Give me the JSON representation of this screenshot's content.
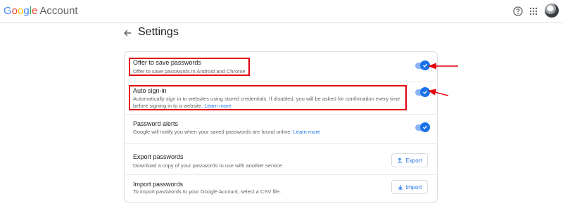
{
  "app": {
    "logo_parts": [
      "G",
      "o",
      "o",
      "g",
      "l",
      "e"
    ],
    "logo_suffix": "Account"
  },
  "header": {
    "icons": [
      "help-icon",
      "apps-grid-icon",
      "avatar"
    ]
  },
  "page": {
    "title": "Settings",
    "back_icon": "arrow-left-icon"
  },
  "settings": {
    "offer_save": {
      "title": "Offer to save passwords",
      "desc": "Offer to save passwords in Android and Chrome",
      "enabled": true
    },
    "auto_signin": {
      "title": "Auto sign-in",
      "desc_line1": "Automatically sign in to websites using stored credentials. If disabled, you will be asked for confirmation every time",
      "desc_line2": "before signing in to a website.",
      "link": "Learn more",
      "enabled": true
    },
    "password_alerts": {
      "title": "Password alerts",
      "desc": "Google will notify you when your saved passwords are found online.",
      "link": "Learn more",
      "enabled": true
    },
    "export": {
      "title": "Export passwords",
      "desc": "Download a copy of your passwords to use with another service",
      "button": "Export"
    },
    "import": {
      "title": "Import passwords",
      "desc": "To import passwords to your Google Account, select a CSV file.",
      "button": "Import"
    }
  },
  "colors": {
    "accent": "#1a73e8",
    "toggle_track": "#8ab4f8",
    "annotation_red": "#e3000f"
  }
}
